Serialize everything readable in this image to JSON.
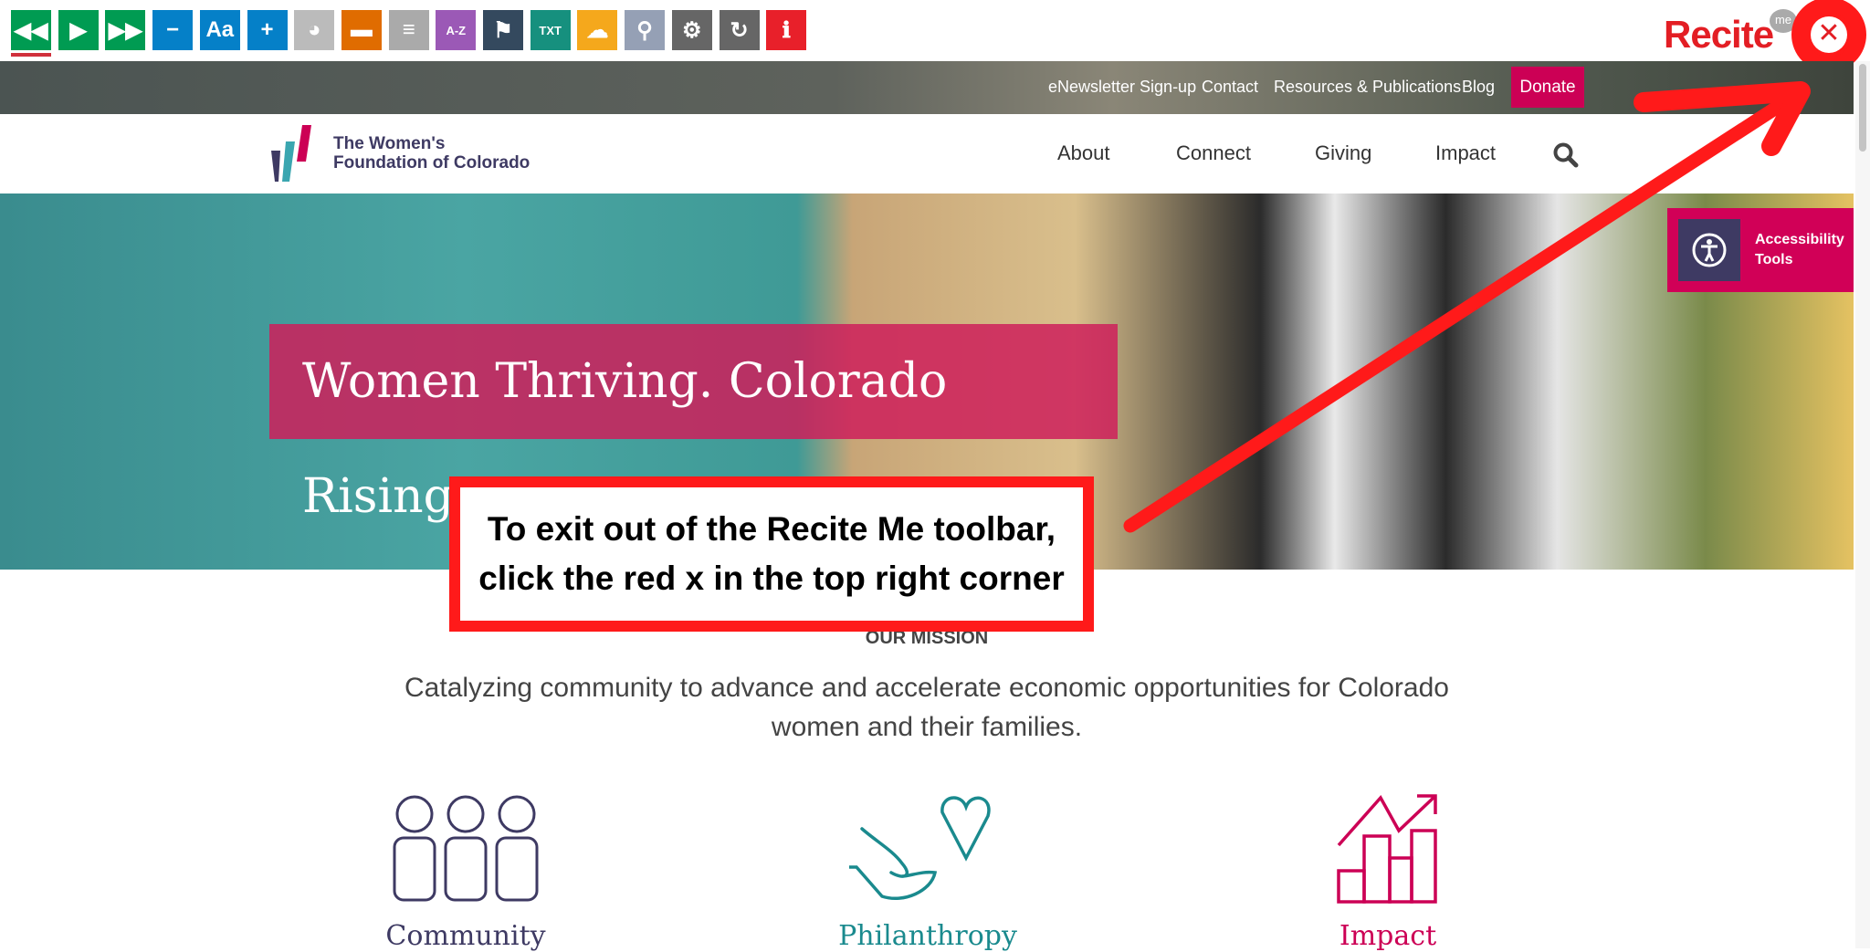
{
  "toolbar": {
    "buttons": [
      {
        "name": "rewind-icon",
        "color": "#009b52",
        "glyph": "◀◀"
      },
      {
        "name": "play-icon",
        "color": "#009b52",
        "glyph": "▶"
      },
      {
        "name": "fast-forward-icon",
        "color": "#009b52",
        "glyph": "▶▶"
      },
      {
        "name": "decrease-text-icon",
        "color": "#0580c8",
        "glyph": "−"
      },
      {
        "name": "font-icon",
        "color": "#0580c8",
        "glyph": "Aa"
      },
      {
        "name": "increase-text-icon",
        "color": "#0580c8",
        "glyph": "+"
      },
      {
        "name": "color-wheel-icon",
        "color": "#bbbbbb",
        "glyph": "◕"
      },
      {
        "name": "ruler-icon",
        "color": "#e06c00",
        "glyph": "▬"
      },
      {
        "name": "text-mask-icon",
        "color": "#aaaaaa",
        "glyph": "≡"
      },
      {
        "name": "dictionary-icon",
        "color": "#9b59b6",
        "glyph": "A-Z"
      },
      {
        "name": "translate-icon",
        "color": "#34495e",
        "glyph": "⚑"
      },
      {
        "name": "text-only-icon",
        "color": "#16907e",
        "glyph": "TXT"
      },
      {
        "name": "download-audio-icon",
        "color": "#f5a81c",
        "glyph": "☁"
      },
      {
        "name": "magnifier-icon",
        "color": "#95a0b5",
        "glyph": "⚲"
      },
      {
        "name": "settings-icon",
        "color": "#666666",
        "glyph": "⚙"
      },
      {
        "name": "reset-icon",
        "color": "#666666",
        "glyph": "↻"
      },
      {
        "name": "info-icon",
        "color": "#e8202a",
        "glyph": "ℹ"
      }
    ],
    "brand": "Recite",
    "brand_badge": "me"
  },
  "utility_nav": [
    "eNewsletter Sign-up",
    "Contact",
    "Resources & Publications",
    "Blog"
  ],
  "donate": "Donate",
  "logo": {
    "line1": "The Women's",
    "line2": "Foundation of Colorado"
  },
  "main_nav": [
    "About",
    "Connect",
    "Giving",
    "Impact"
  ],
  "hero": {
    "headline": "Women Thriving. Colorado Rising."
  },
  "accessibility": {
    "line1": "Accessibility",
    "line2": "Tools"
  },
  "callout": {
    "line1": "To exit out of the Recite Me toolbar,",
    "line2": "click the red x in the top right corner"
  },
  "mission": {
    "heading": "OUR MISSION",
    "text": "Catalyzing community to advance and accelerate economic opportunities for Colorado women and their families."
  },
  "features": [
    {
      "label": "Community",
      "color": "#3e3a63"
    },
    {
      "label": "Philanthropy",
      "color": "#1a8a8e"
    },
    {
      "label": "Impact",
      "color": "#cc0055"
    }
  ]
}
